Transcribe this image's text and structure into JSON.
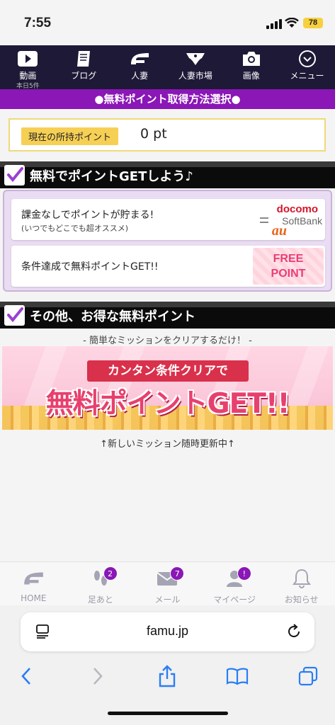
{
  "status_bar": {
    "time": "7:55",
    "battery": "78"
  },
  "top_nav": {
    "items": [
      {
        "label": "動画",
        "sub": "本日5件",
        "icon": "play-icon"
      },
      {
        "label": "ブログ",
        "sub": "",
        "icon": "book-icon"
      },
      {
        "label": "人妻",
        "sub": "",
        "icon": "logo-icon"
      },
      {
        "label": "人妻市場",
        "sub": "",
        "icon": "lingerie-icon"
      },
      {
        "label": "画像",
        "sub": "",
        "icon": "camera-icon"
      },
      {
        "label": "メニュー",
        "sub": "",
        "icon": "chevron-circle-icon"
      }
    ]
  },
  "page_header": {
    "title": "●無料ポイント取得方法選択●"
  },
  "points": {
    "label": "現在の所持ポイント",
    "value": "0 pt"
  },
  "section_free": {
    "title": "無料でポイントGETしよう♪",
    "offers": [
      {
        "line1": "課金なしでポイントが貯まる!",
        "line2": "(いつでもどこでも超オススメ)",
        "logo_docomo": "docomo",
        "logo_softbank": "SoftBank",
        "logo_au": "au"
      },
      {
        "line1": "条件達成で無料ポイントGET!!",
        "badge_line1": "FREE",
        "badge_line2": "POINT"
      }
    ]
  },
  "section_other": {
    "title": "その他、お得な無料ポイント",
    "subtitle": "- 簡単なミッションをクリアするだけ！ -",
    "banner": {
      "ribbon": "カンタン条件クリアで",
      "headline": "無料ポイントGET!!"
    },
    "note": "↑新しいミッション随時更新中↑"
  },
  "bottom_nav": {
    "tabs": [
      {
        "label": "HOME",
        "icon": "home-logo-icon",
        "badge": ""
      },
      {
        "label": "足あと",
        "icon": "footprints-icon",
        "badge": "2"
      },
      {
        "label": "メール",
        "icon": "mail-icon",
        "badge": "7"
      },
      {
        "label": "マイページ",
        "icon": "user-icon",
        "badge": "!"
      },
      {
        "label": "お知らせ",
        "icon": "bell-icon",
        "badge": ""
      }
    ]
  },
  "browser": {
    "url": "famu.jp"
  },
  "colors": {
    "nav_bg": "#1d1936",
    "accent_purple": "#8a17b6",
    "points_label_bg": "#f6cf55"
  }
}
